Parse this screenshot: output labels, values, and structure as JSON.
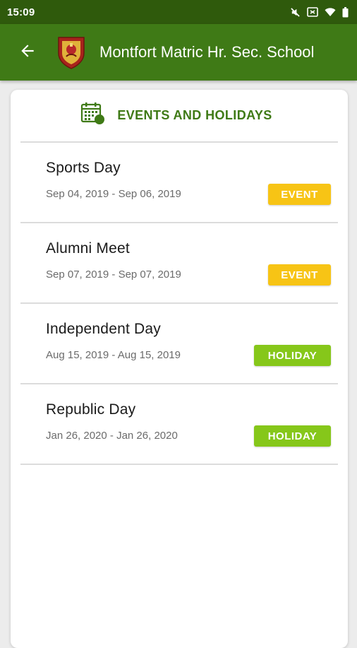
{
  "status_bar": {
    "time": "15:09",
    "icons": [
      "mute-icon",
      "cast-icon",
      "wifi-icon",
      "battery-icon"
    ]
  },
  "app_bar": {
    "title": "Montfort Matric Hr. Sec. School",
    "back_icon": "back-arrow-icon",
    "logo": "school-crest-logo"
  },
  "card": {
    "title": "EVENTS AND HOLIDAYS",
    "icon": "calendar-icon"
  },
  "events": [
    {
      "title": "Sports Day",
      "dates": "Sep 04, 2019 - Sep 06, 2019",
      "badge": "EVENT",
      "type": "event"
    },
    {
      "title": "Alumni Meet",
      "dates": "Sep 07, 2019 - Sep 07, 2019",
      "badge": "EVENT",
      "type": "event"
    },
    {
      "title": "Independent Day",
      "dates": "Aug 15, 2019 - Aug 15, 2019",
      "badge": "HOLIDAY",
      "type": "holiday"
    },
    {
      "title": "Republic Day",
      "dates": "Jan 26, 2020 - Jan 26, 2020",
      "badge": "HOLIDAY",
      "type": "holiday"
    }
  ],
  "colors": {
    "status_bar": "#2f5a0c",
    "app_bar": "#3f7a16",
    "event_badge": "#f7c415",
    "holiday_badge": "#86c71a"
  }
}
